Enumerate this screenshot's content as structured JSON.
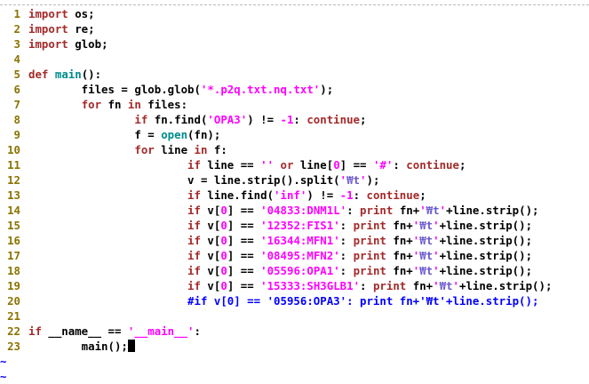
{
  "editor": {
    "lines": [
      {
        "n": "1",
        "tokens": [
          [
            "kw",
            "import"
          ],
          [
            "tx",
            " os;"
          ]
        ]
      },
      {
        "n": "2",
        "tokens": [
          [
            "kw",
            "import"
          ],
          [
            "tx",
            " re;"
          ]
        ]
      },
      {
        "n": "3",
        "tokens": [
          [
            "kw",
            "import"
          ],
          [
            "tx",
            " glob;"
          ]
        ]
      },
      {
        "n": "4",
        "tokens": []
      },
      {
        "n": "5",
        "tokens": [
          [
            "kw",
            "def"
          ],
          [
            "tx",
            " "
          ],
          [
            "fn",
            "main"
          ],
          [
            "tx",
            "():"
          ]
        ]
      },
      {
        "n": "6",
        "tokens": [
          [
            "tx",
            "        files = glob.glob("
          ],
          [
            "st",
            "'*.p2q.txt.nq.txt'"
          ],
          [
            "tx",
            ");"
          ]
        ]
      },
      {
        "n": "7",
        "tokens": [
          [
            "tx",
            "        "
          ],
          [
            "kw",
            "for"
          ],
          [
            "tx",
            " fn "
          ],
          [
            "kw",
            "in"
          ],
          [
            "tx",
            " files:"
          ]
        ]
      },
      {
        "n": "8",
        "tokens": [
          [
            "tx",
            "                "
          ],
          [
            "kw",
            "if"
          ],
          [
            "tx",
            " fn.find("
          ],
          [
            "st",
            "'OPA3'"
          ],
          [
            "tx",
            ") != "
          ],
          [
            "st",
            "-1"
          ],
          [
            "tx",
            ": "
          ],
          [
            "kw",
            "continue"
          ],
          [
            "tx",
            ";"
          ]
        ]
      },
      {
        "n": "9",
        "tokens": [
          [
            "tx",
            "                f = "
          ],
          [
            "fn",
            "open"
          ],
          [
            "tx",
            "(fn);"
          ]
        ]
      },
      {
        "n": "10",
        "tokens": [
          [
            "tx",
            "                "
          ],
          [
            "kw",
            "for"
          ],
          [
            "tx",
            " line "
          ],
          [
            "kw",
            "in"
          ],
          [
            "tx",
            " f:"
          ]
        ]
      },
      {
        "n": "11",
        "tokens": [
          [
            "tx",
            "                        "
          ],
          [
            "kw",
            "if"
          ],
          [
            "tx",
            " line == "
          ],
          [
            "st",
            "''"
          ],
          [
            "tx",
            " "
          ],
          [
            "kw",
            "or"
          ],
          [
            "tx",
            " line["
          ],
          [
            "st",
            "0"
          ],
          [
            "tx",
            "] == "
          ],
          [
            "st",
            "'#'"
          ],
          [
            "tx",
            ": "
          ],
          [
            "kw",
            "continue"
          ],
          [
            "tx",
            ";"
          ]
        ]
      },
      {
        "n": "12",
        "tokens": [
          [
            "tx",
            "                        v = line.strip().split("
          ],
          [
            "st",
            "'"
          ],
          [
            "sp",
            "₩t"
          ],
          [
            "st",
            "'"
          ],
          [
            "tx",
            ");"
          ]
        ]
      },
      {
        "n": "13",
        "tokens": [
          [
            "tx",
            "                        "
          ],
          [
            "kw",
            "if"
          ],
          [
            "tx",
            " line.find("
          ],
          [
            "st",
            "'inf'"
          ],
          [
            "tx",
            ") != "
          ],
          [
            "st",
            "-1"
          ],
          [
            "tx",
            ": "
          ],
          [
            "kw",
            "continue"
          ],
          [
            "tx",
            ";"
          ]
        ]
      },
      {
        "n": "14",
        "tokens": [
          [
            "tx",
            "                        "
          ],
          [
            "kw",
            "if"
          ],
          [
            "tx",
            " v["
          ],
          [
            "st",
            "0"
          ],
          [
            "tx",
            "] == "
          ],
          [
            "st",
            "'04833:DNM1L'"
          ],
          [
            "tx",
            ": "
          ],
          [
            "kw",
            "print"
          ],
          [
            "tx",
            " fn+"
          ],
          [
            "st",
            "'"
          ],
          [
            "sp",
            "₩t"
          ],
          [
            "st",
            "'"
          ],
          [
            "tx",
            "+line.strip();"
          ]
        ]
      },
      {
        "n": "15",
        "tokens": [
          [
            "tx",
            "                        "
          ],
          [
            "kw",
            "if"
          ],
          [
            "tx",
            " v["
          ],
          [
            "st",
            "0"
          ],
          [
            "tx",
            "] == "
          ],
          [
            "st",
            "'12352:FIS1'"
          ],
          [
            "tx",
            ": "
          ],
          [
            "kw",
            "print"
          ],
          [
            "tx",
            " fn+"
          ],
          [
            "st",
            "'"
          ],
          [
            "sp",
            "₩t"
          ],
          [
            "st",
            "'"
          ],
          [
            "tx",
            "+line.strip();"
          ]
        ]
      },
      {
        "n": "16",
        "tokens": [
          [
            "tx",
            "                        "
          ],
          [
            "kw",
            "if"
          ],
          [
            "tx",
            " v["
          ],
          [
            "st",
            "0"
          ],
          [
            "tx",
            "] == "
          ],
          [
            "st",
            "'16344:MFN1'"
          ],
          [
            "tx",
            ": "
          ],
          [
            "kw",
            "print"
          ],
          [
            "tx",
            " fn+"
          ],
          [
            "st",
            "'"
          ],
          [
            "sp",
            "₩t"
          ],
          [
            "st",
            "'"
          ],
          [
            "tx",
            "+line.strip();"
          ]
        ]
      },
      {
        "n": "17",
        "tokens": [
          [
            "tx",
            "                        "
          ],
          [
            "kw",
            "if"
          ],
          [
            "tx",
            " v["
          ],
          [
            "st",
            "0"
          ],
          [
            "tx",
            "] == "
          ],
          [
            "st",
            "'08495:MFN2'"
          ],
          [
            "tx",
            ": "
          ],
          [
            "kw",
            "print"
          ],
          [
            "tx",
            " fn+"
          ],
          [
            "st",
            "'"
          ],
          [
            "sp",
            "₩t"
          ],
          [
            "st",
            "'"
          ],
          [
            "tx",
            "+line.strip();"
          ]
        ]
      },
      {
        "n": "18",
        "tokens": [
          [
            "tx",
            "                        "
          ],
          [
            "kw",
            "if"
          ],
          [
            "tx",
            " v["
          ],
          [
            "st",
            "0"
          ],
          [
            "tx",
            "] == "
          ],
          [
            "st",
            "'05596:OPA1'"
          ],
          [
            "tx",
            ": "
          ],
          [
            "kw",
            "print"
          ],
          [
            "tx",
            " fn+"
          ],
          [
            "st",
            "'"
          ],
          [
            "sp",
            "₩t"
          ],
          [
            "st",
            "'"
          ],
          [
            "tx",
            "+line.strip();"
          ]
        ]
      },
      {
        "n": "19",
        "tokens": [
          [
            "tx",
            "                        "
          ],
          [
            "kw",
            "if"
          ],
          [
            "tx",
            " v["
          ],
          [
            "st",
            "0"
          ],
          [
            "tx",
            "] == "
          ],
          [
            "st",
            "'15333:SH3GLB1'"
          ],
          [
            "tx",
            ": "
          ],
          [
            "kw",
            "print"
          ],
          [
            "tx",
            " fn+"
          ],
          [
            "st",
            "'"
          ],
          [
            "sp",
            "₩t"
          ],
          [
            "st",
            "'"
          ],
          [
            "tx",
            "+line.strip();"
          ]
        ]
      },
      {
        "n": "20",
        "tokens": [
          [
            "tx",
            "                        "
          ],
          [
            "cmt",
            "#if v[0] == '05956:OPA3': print fn+'₩t'+line.strip();"
          ]
        ]
      },
      {
        "n": "21",
        "tokens": []
      },
      {
        "n": "22",
        "tokens": [
          [
            "kw",
            "if"
          ],
          [
            "tx",
            " __name__ == "
          ],
          [
            "st",
            "'__main__'"
          ],
          [
            "tx",
            ":"
          ]
        ]
      },
      {
        "n": "23",
        "tokens": [
          [
            "tx",
            "        main();"
          ]
        ],
        "cursor": true
      }
    ],
    "tilde_lines": [
      "~",
      "~"
    ]
  }
}
